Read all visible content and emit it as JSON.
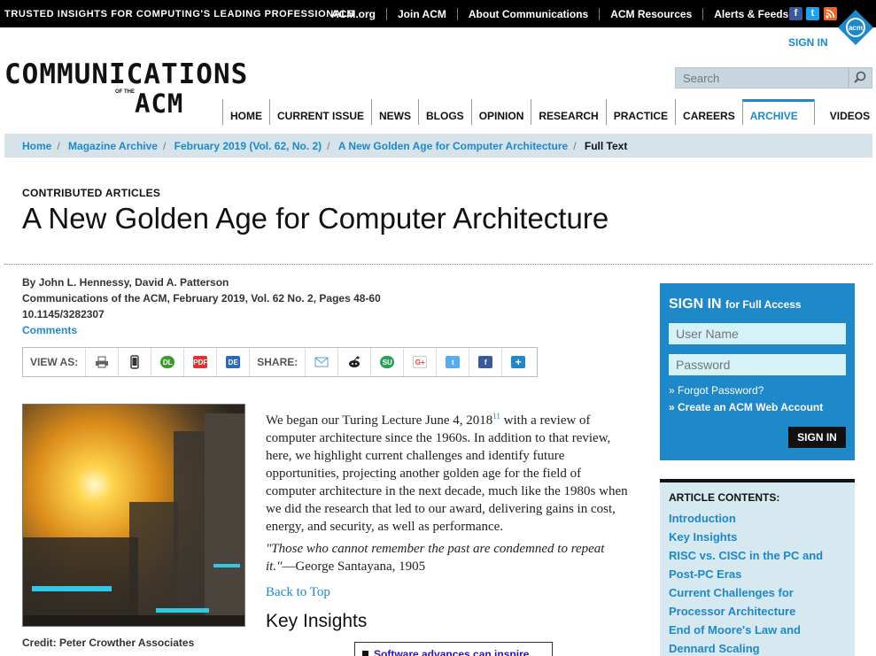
{
  "topbar": {
    "tagline": "TRUSTED INSIGHTS FOR COMPUTING'S LEADING PROFESSIONALS",
    "links": [
      "ACM.org",
      "Join ACM",
      "About Communications",
      "ACM Resources",
      "Alerts & Feeds"
    ],
    "sign_in": "SIGN IN"
  },
  "logo": {
    "main": "COMMUNICATIONS",
    "of_the": "OF THE",
    "acm": "ACM",
    "badge": "acm"
  },
  "search": {
    "placeholder": "Search"
  },
  "nav": [
    "HOME",
    "CURRENT ISSUE",
    "NEWS",
    "BLOGS",
    "OPINION",
    "RESEARCH",
    "PRACTICE",
    "CAREERS",
    "ARCHIVE",
    "VIDEOS"
  ],
  "nav_active": "ARCHIVE",
  "breadcrumb": {
    "items": [
      "Home",
      "Magazine Archive",
      "February 2019 (Vol. 62, No. 2)",
      "A New Golden Age for Computer Architecture"
    ],
    "current": "Full Text"
  },
  "article": {
    "section": "CONTRIBUTED ARTICLES",
    "title": "A New Golden Age for Computer Architecture",
    "authors": "By John L. Hennessy, David A. Patterson",
    "citation": "Communications of the ACM, February 2019, Vol. 62 No. 2, Pages 48-60",
    "doi": "10.1145/3282307",
    "comments": "Comments",
    "view_as": "VIEW AS:",
    "share": "SHARE:",
    "image_credit": "Credit: Peter Crowther Associates",
    "para1_before": "We began our Turing Lecture June 4, 2018",
    "para1_sup": "11",
    "para1_after": " with a review of computer architecture since the 1960s. In addition to that review, here, we highlight current challenges and identify future opportunities, projecting another golden age for the field of computer architecture in the next decade, much like the 1980s when we did the research that led to our award, delivering gains in cost, energy, and security, as well as performance.",
    "quote_text": "\"Those who cannot remember the past are condemned to repeat it.\"",
    "quote_attr": "—George Santayana, 1905",
    "back_to_top": "Back to Top",
    "key_insights": "Key Insights",
    "insight_1": "Software advances can inspire"
  },
  "view_icons": [
    "print-icon",
    "mobile-icon",
    "digital-library-icon",
    "pdf-icon",
    "digital-edition-icon"
  ],
  "share_icons": [
    "email-icon",
    "reddit-icon",
    "stumbleupon-icon",
    "google-plus-icon",
    "twitter-icon",
    "facebook-icon",
    "more-share-icon"
  ],
  "view_icon_labels": {
    "dl": "DL",
    "pdf": "PDF",
    "de": "DE"
  },
  "share_icon_labels": {
    "su": "SU",
    "gplus": "G+",
    "fb": "f",
    "tw": "t",
    "more": "+"
  },
  "signin_panel": {
    "title": "SIGN IN",
    "subtitle": "for Full Access",
    "username_placeholder": "User Name",
    "password_placeholder": "Password",
    "forgot": "» Forgot Password?",
    "create": "» Create an ACM Web Account",
    "button": "SIGN IN"
  },
  "contents": {
    "header": "ARTICLE CONTENTS:",
    "items": [
      "Introduction",
      "Key Insights",
      "RISC vs. CISC in the PC and",
      "Post-PC Eras",
      "Current Challenges for",
      "Processor Architecture",
      "End of Moore's Law and",
      "Dennard Scaling"
    ]
  },
  "colors": {
    "accent": "#1e88c8",
    "topbar": "#000000",
    "breadcrumb_bg": "#d6e3ea",
    "panel_bg": "#1e88c8",
    "contents_bg": "#d6e8f0"
  }
}
